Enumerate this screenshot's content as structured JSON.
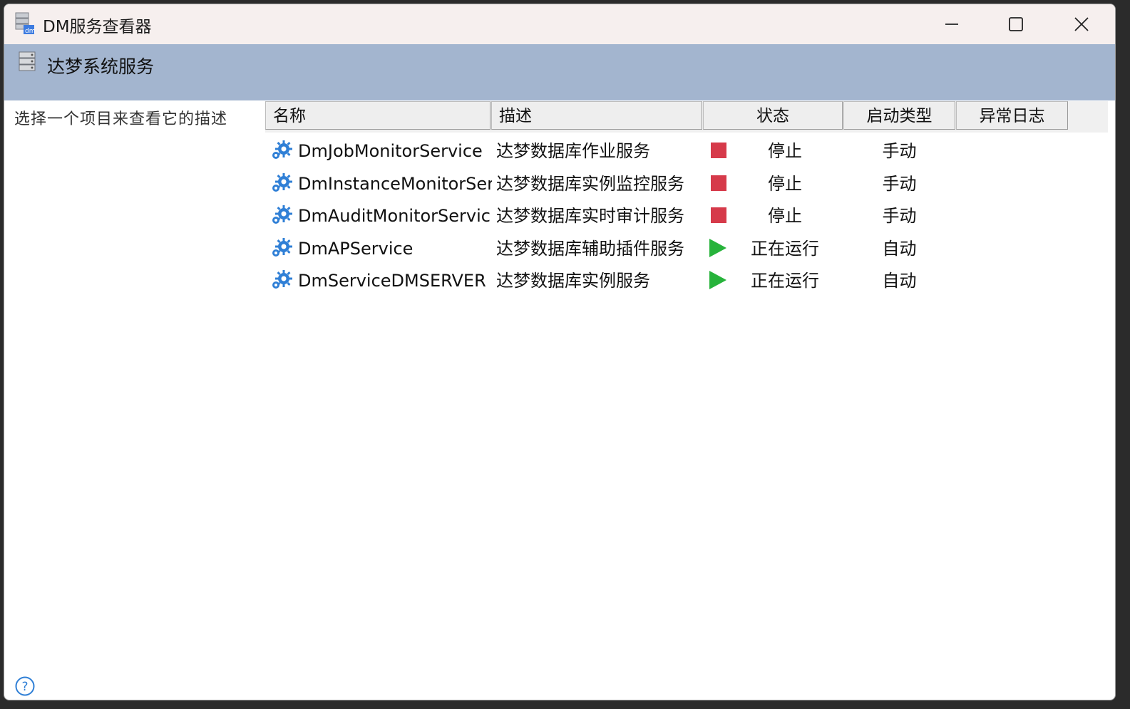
{
  "window": {
    "title": "DM服务查看器",
    "minimize_label": "minimize",
    "maximize_label": "maximize",
    "close_label": "close"
  },
  "header": {
    "title": "达梦系统服务"
  },
  "description_panel": {
    "text": "选择一个项目来查看它的描述"
  },
  "columns": [
    "名称",
    "描述",
    "状态",
    "启动类型",
    "异常日志"
  ],
  "services": [
    {
      "name": "DmJobMonitorService",
      "description": "达梦数据库作业服务",
      "status": "停止",
      "status_icon": "stop",
      "startup": "手动",
      "log": ""
    },
    {
      "name": "DmInstanceMonitorSer..",
      "description": "达梦数据库实例监控服务",
      "status": "停止",
      "status_icon": "stop",
      "startup": "手动",
      "log": ""
    },
    {
      "name": "DmAuditMonitorServic..",
      "description": "达梦数据库实时审计服务",
      "status": "停止",
      "status_icon": "stop",
      "startup": "手动",
      "log": ""
    },
    {
      "name": "DmAPService",
      "description": "达梦数据库辅助插件服务",
      "status": "正在运行",
      "status_icon": "running",
      "startup": "自动",
      "log": ""
    },
    {
      "name": "DmServiceDMSERVER",
      "description": "达梦数据库实例服务",
      "status": "正在运行",
      "status_icon": "running",
      "startup": "自动",
      "log": ""
    }
  ],
  "colors": {
    "header_band": "#a3b5cf",
    "titlebar": "#f6efee",
    "stopped": "#d63a4a",
    "running": "#27b33b",
    "gear_icon": "#2f7fd6"
  }
}
